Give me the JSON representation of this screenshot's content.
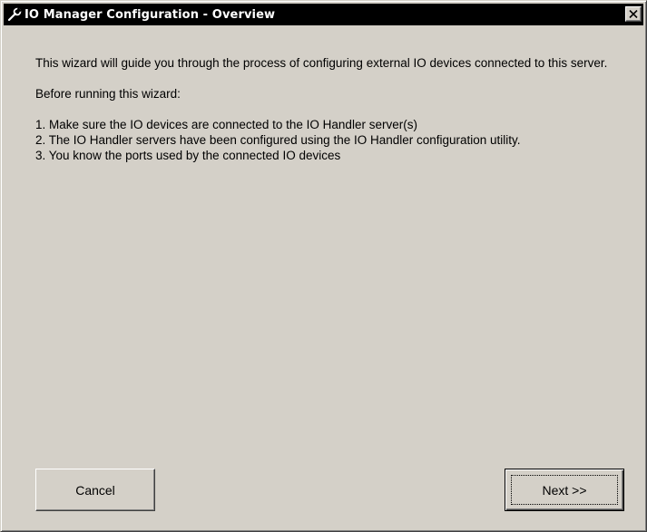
{
  "window": {
    "title": "IO Manager Configuration - Overview",
    "title_icon": "wrench-icon",
    "close_icon": "close-icon"
  },
  "content": {
    "intro": "This wizard will guide you through the process of configuring external IO devices connected to this server.",
    "before": "Before running this wizard:",
    "steps": [
      "1. Make sure the IO devices are connected to the IO Handler server(s)",
      "2. The IO Handler servers have been configured using the IO Handler configuration utility.",
      "3. You know the ports used by the connected IO devices"
    ]
  },
  "buttons": {
    "cancel": "Cancel",
    "next": "Next >>"
  }
}
